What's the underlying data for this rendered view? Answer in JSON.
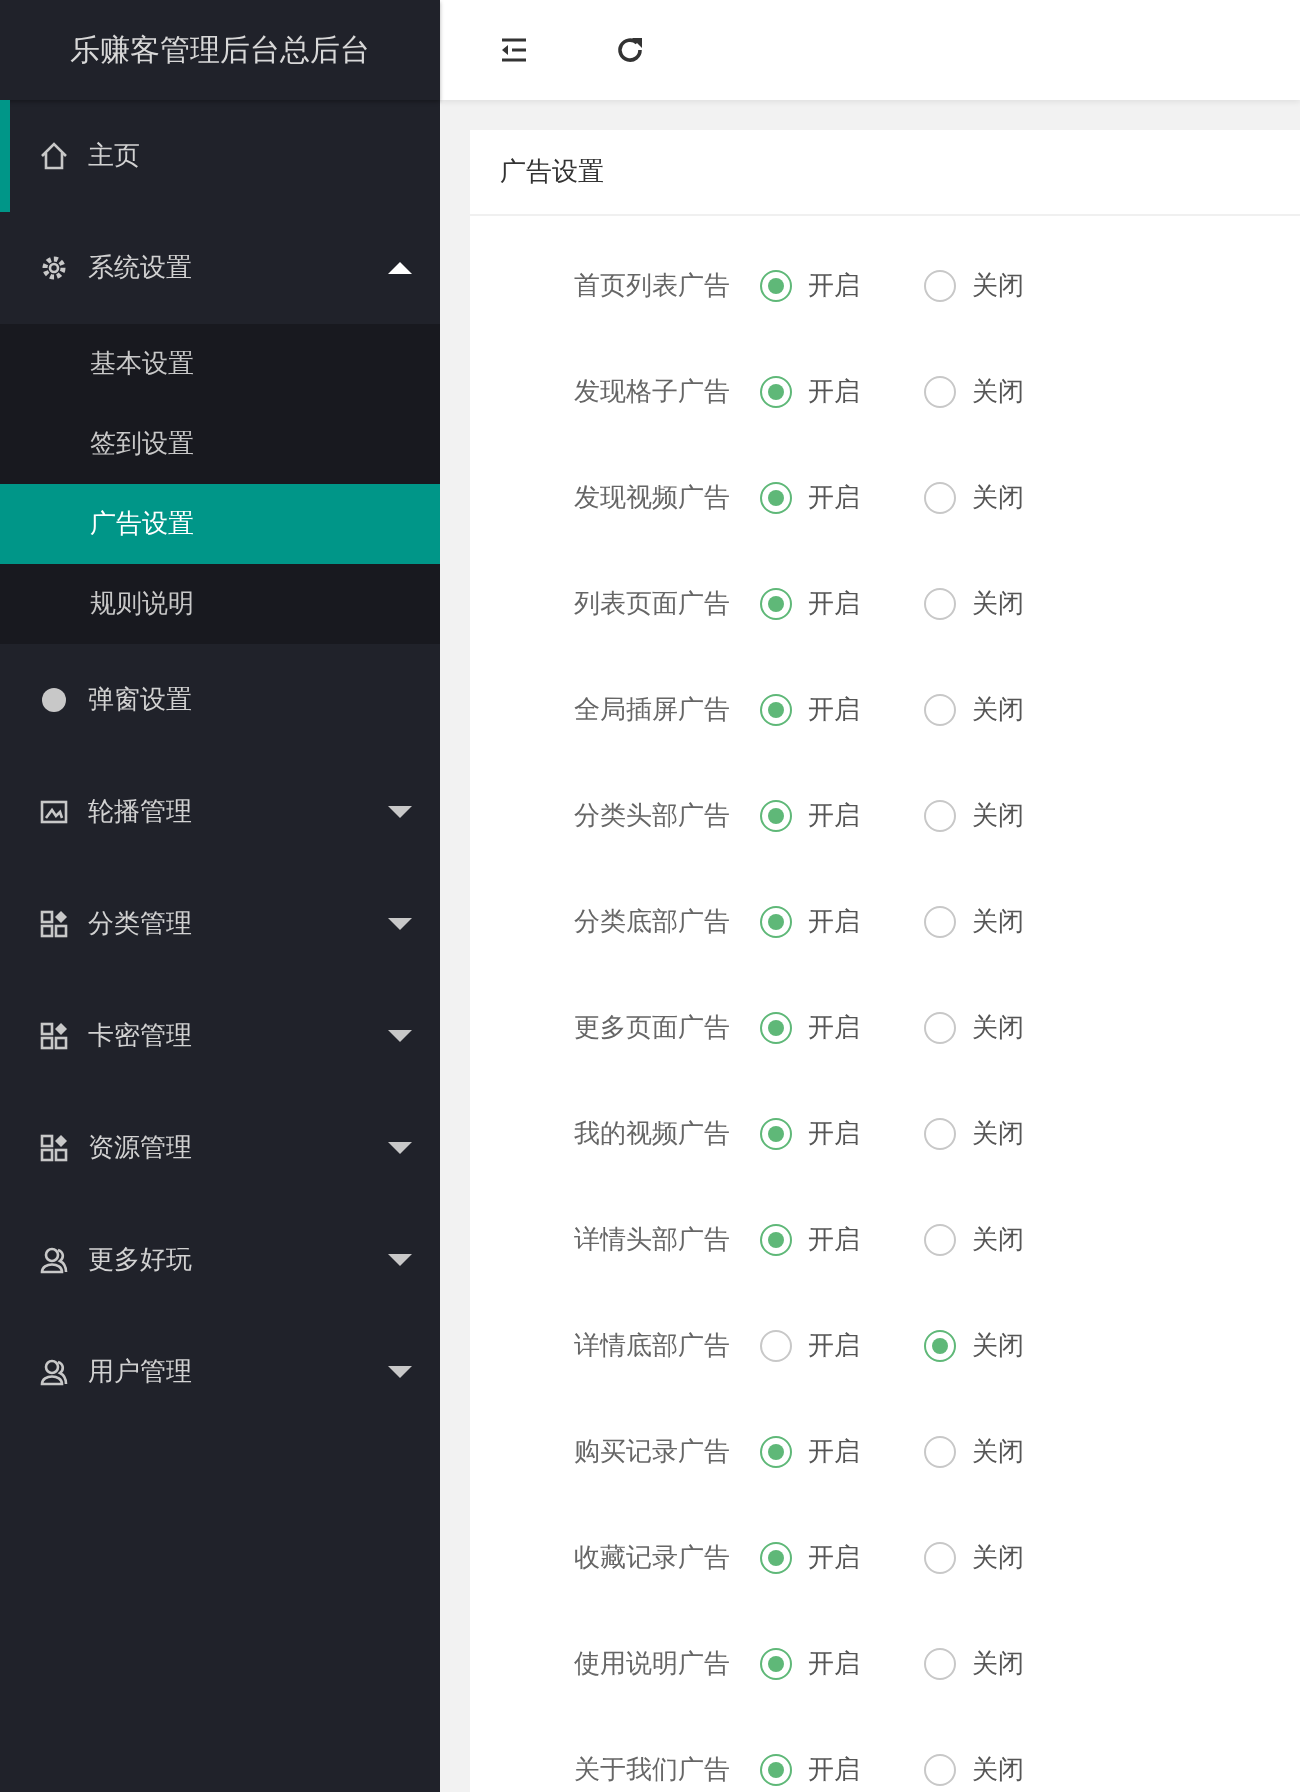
{
  "logo": "乐赚客管理后台总后台",
  "sidebar": {
    "items": [
      {
        "label": "主页",
        "kind": "home"
      },
      {
        "label": "系统设置",
        "kind": "gear",
        "expanded": true,
        "children": [
          {
            "label": "基本设置",
            "selected": false
          },
          {
            "label": "签到设置",
            "selected": false
          },
          {
            "label": "广告设置",
            "selected": true
          },
          {
            "label": "规则说明",
            "selected": false
          }
        ]
      },
      {
        "label": "弹窗设置",
        "kind": "dot"
      },
      {
        "label": "轮播管理",
        "kind": "image",
        "expanded": false
      },
      {
        "label": "分类管理",
        "kind": "grid",
        "expanded": false
      },
      {
        "label": "卡密管理",
        "kind": "grid",
        "expanded": false
      },
      {
        "label": "资源管理",
        "kind": "grid",
        "expanded": false
      },
      {
        "label": "更多好玩",
        "kind": "user",
        "expanded": false
      },
      {
        "label": "用户管理",
        "kind": "user",
        "expanded": false
      }
    ]
  },
  "card": {
    "title": "广告设置",
    "rows": [
      {
        "label": "首页列表广告",
        "options": [
          {
            "label": "开启",
            "selected": true
          },
          {
            "label": "关闭",
            "selected": false
          }
        ]
      },
      {
        "label": "发现格子广告",
        "options": [
          {
            "label": "开启",
            "selected": true
          },
          {
            "label": "关闭",
            "selected": false
          }
        ]
      },
      {
        "label": "发现视频广告",
        "options": [
          {
            "label": "开启",
            "selected": true
          },
          {
            "label": "关闭",
            "selected": false
          }
        ]
      },
      {
        "label": "列表页面广告",
        "options": [
          {
            "label": "开启",
            "selected": true
          },
          {
            "label": "关闭",
            "selected": false
          }
        ]
      },
      {
        "label": "全局插屏广告",
        "options": [
          {
            "label": "开启",
            "selected": true
          },
          {
            "label": "关闭",
            "selected": false
          }
        ]
      },
      {
        "label": "分类头部广告",
        "options": [
          {
            "label": "开启",
            "selected": true
          },
          {
            "label": "关闭",
            "selected": false
          }
        ]
      },
      {
        "label": "分类底部广告",
        "options": [
          {
            "label": "开启",
            "selected": true
          },
          {
            "label": "关闭",
            "selected": false
          }
        ]
      },
      {
        "label": "更多页面广告",
        "options": [
          {
            "label": "开启",
            "selected": true
          },
          {
            "label": "关闭",
            "selected": false
          }
        ]
      },
      {
        "label": "我的视频广告",
        "options": [
          {
            "label": "开启",
            "selected": true
          },
          {
            "label": "关闭",
            "selected": false
          }
        ]
      },
      {
        "label": "详情头部广告",
        "options": [
          {
            "label": "开启",
            "selected": true
          },
          {
            "label": "关闭",
            "selected": false
          }
        ]
      },
      {
        "label": "详情底部广告",
        "options": [
          {
            "label": "开启",
            "selected": false
          },
          {
            "label": "关闭",
            "selected": true
          }
        ]
      },
      {
        "label": "购买记录广告",
        "options": [
          {
            "label": "开启",
            "selected": true
          },
          {
            "label": "关闭",
            "selected": false
          }
        ]
      },
      {
        "label": "收藏记录广告",
        "options": [
          {
            "label": "开启",
            "selected": true
          },
          {
            "label": "关闭",
            "selected": false
          }
        ]
      },
      {
        "label": "使用说明广告",
        "options": [
          {
            "label": "开启",
            "selected": true
          },
          {
            "label": "关闭",
            "selected": false
          }
        ]
      },
      {
        "label": "关于我们广告",
        "options": [
          {
            "label": "开启",
            "selected": true
          },
          {
            "label": "关闭",
            "selected": false
          }
        ]
      }
    ]
  }
}
